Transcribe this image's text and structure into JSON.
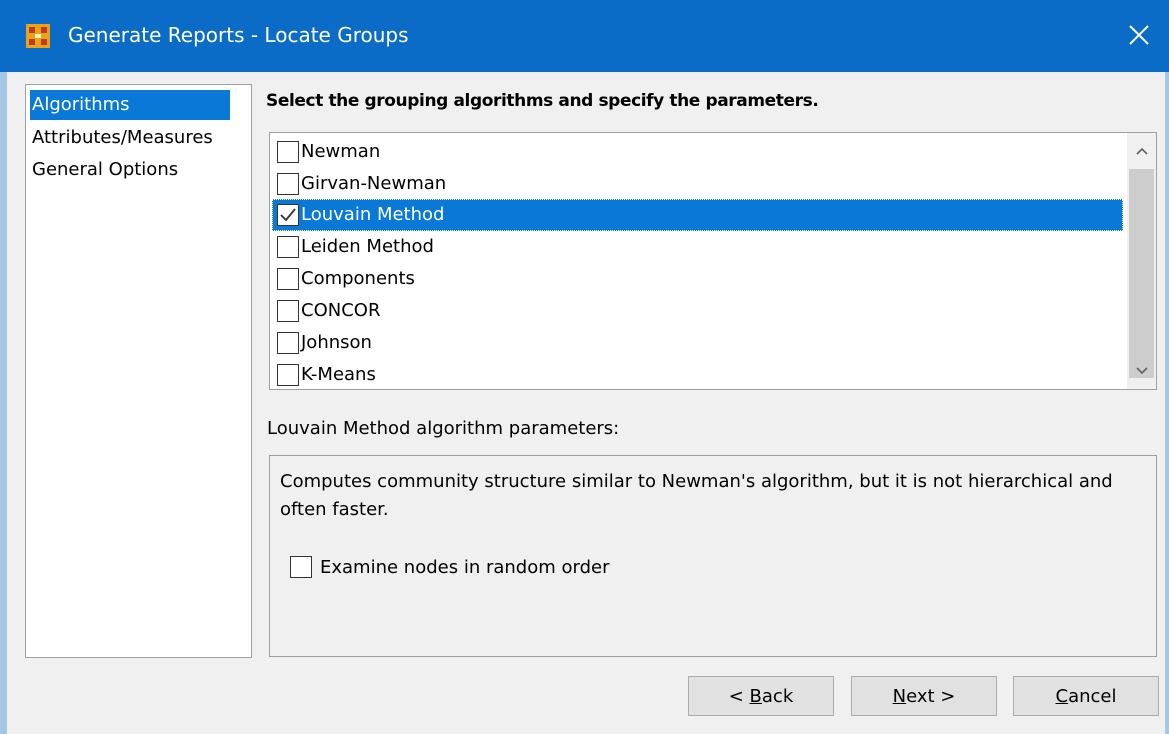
{
  "window": {
    "title": "Generate Reports - Locate Groups",
    "close_glyph": "✕"
  },
  "sidebar": {
    "items": [
      {
        "label": "Algorithms",
        "selected": true
      },
      {
        "label": "Attributes/Measures",
        "selected": false
      },
      {
        "label": "General Options",
        "selected": false
      }
    ]
  },
  "main": {
    "heading": "Select the grouping algorithms and specify the parameters.",
    "algorithms": [
      {
        "label": "Newman",
        "checked": false,
        "selected": false
      },
      {
        "label": "Girvan-Newman",
        "checked": false,
        "selected": false
      },
      {
        "label": "Louvain Method",
        "checked": true,
        "selected": true
      },
      {
        "label": "Leiden Method",
        "checked": false,
        "selected": false
      },
      {
        "label": "Components",
        "checked": false,
        "selected": false
      },
      {
        "label": "CONCOR",
        "checked": false,
        "selected": false
      },
      {
        "label": "Johnson",
        "checked": false,
        "selected": false
      },
      {
        "label": "K-Means",
        "checked": false,
        "selected": false
      }
    ],
    "params_label": "Louvain Method algorithm parameters:",
    "params": {
      "description": "Computes community structure similar to Newman's algorithm, but it is not hierarchical and often faster.",
      "option_label": "Examine nodes in random order",
      "option_checked": false
    }
  },
  "buttons": {
    "back": {
      "prefix": "< ",
      "mnemonic": "B",
      "rest": "ack"
    },
    "next": {
      "mnemonic": "N",
      "rest": "ext >"
    },
    "cancel": {
      "mnemonic": "C",
      "rest": "ancel"
    }
  },
  "colors": {
    "titlebar": "#0b6cc7",
    "selection": "#0a78d7",
    "app_icon": "#e8a317"
  }
}
